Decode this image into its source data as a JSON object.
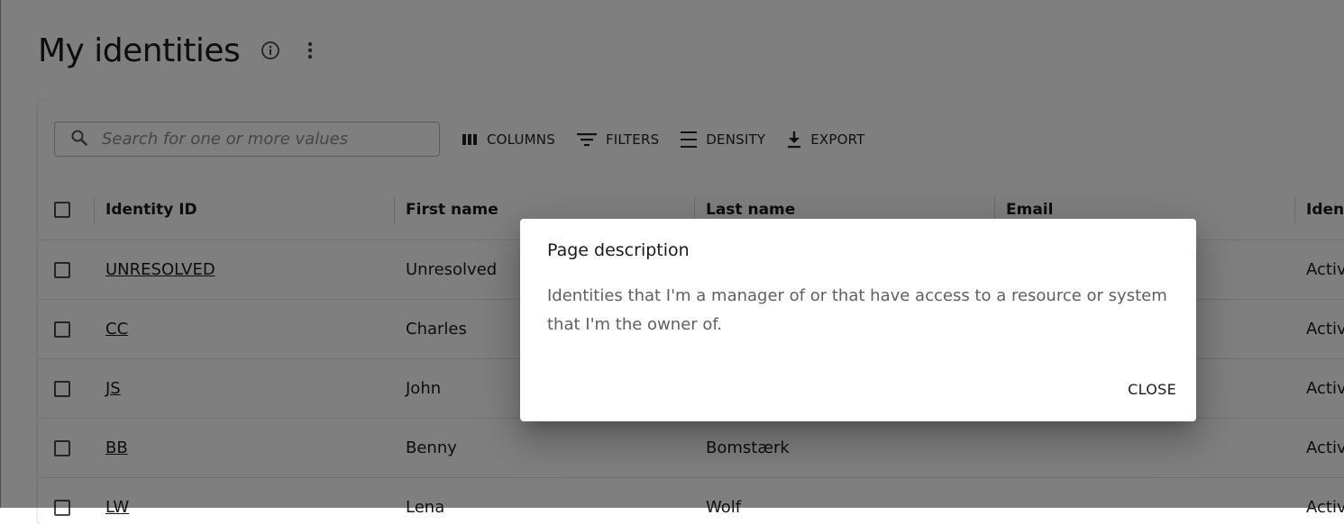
{
  "page": {
    "title": "My identities",
    "info_icon": "info-circle-icon",
    "more_icon": "more-vertical-icon"
  },
  "toolbar": {
    "search_placeholder": "Search for one or more values",
    "columns_label": "COLUMNS",
    "filters_label": "FILTERS",
    "density_label": "DENSITY",
    "export_label": "EXPORT"
  },
  "table": {
    "headers": [
      "Identity ID",
      "First name",
      "Last name",
      "Email",
      "Ident"
    ],
    "rows": [
      {
        "id": "UNRESOLVED",
        "first": "Unresolved",
        "last": "",
        "email": "",
        "state": "Activ"
      },
      {
        "id": "CC",
        "first": "Charles",
        "last": "",
        "email": "",
        "state": "Activ"
      },
      {
        "id": "JS",
        "first": "John",
        "last": "",
        "email": "",
        "state": "Activ"
      },
      {
        "id": "BB",
        "first": "Benny",
        "last": "Bomstærk",
        "email": "",
        "state": "Activ"
      },
      {
        "id": "LW",
        "first": "Lena",
        "last": "Wolf",
        "email": "",
        "state": "Activ"
      }
    ]
  },
  "dialog": {
    "title": "Page description",
    "body": "Identities that I'm a manager of or that have access to a resource or system that I'm the owner of.",
    "close_label": "CLOSE"
  },
  "colors": {
    "backdrop": "#000000",
    "text": "#1b1b1b",
    "dialog_body_text": "#5f5f5f"
  }
}
